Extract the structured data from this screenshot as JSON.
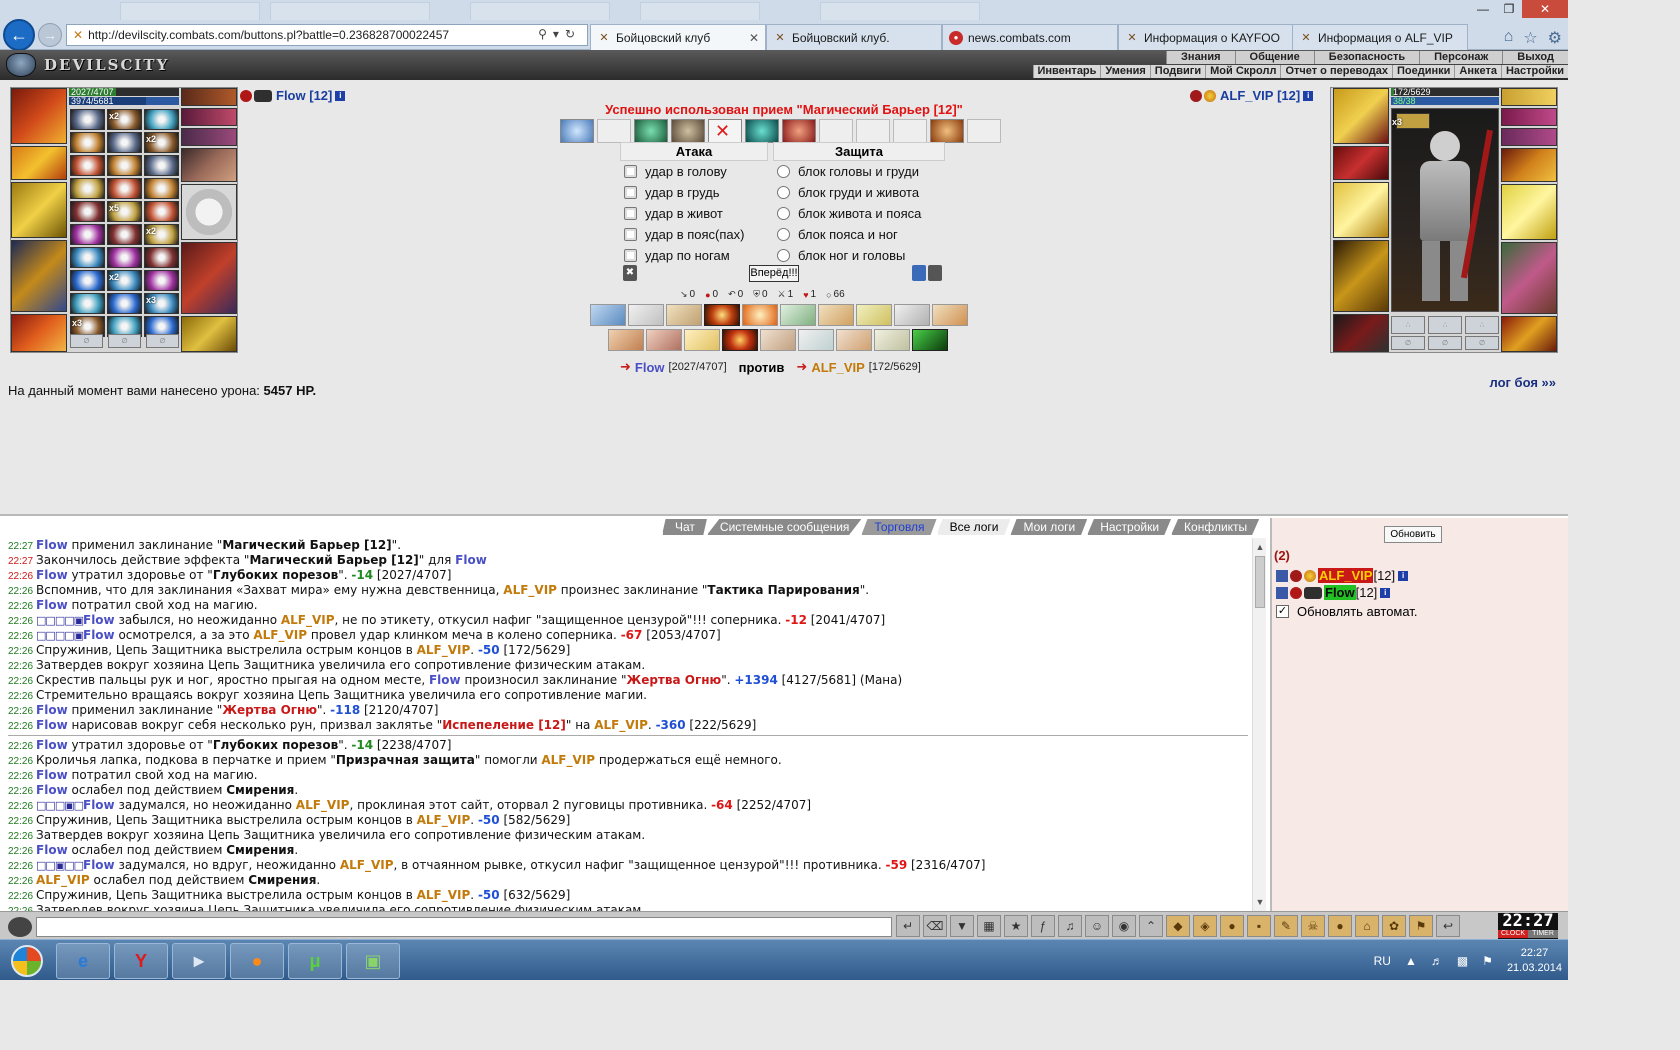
{
  "browser": {
    "url": "http://devilscity.combats.com/buttons.pl?battle=0.236828700022457",
    "url_host": "devilscity.combats.com",
    "tabs": [
      {
        "label": "Бойцовский клуб",
        "active": true
      },
      {
        "label": "Бойцовский клуб.",
        "active": false
      },
      {
        "label": "news.combats.com",
        "active": false
      },
      {
        "label": "Информация о KAYFOO",
        "active": false
      },
      {
        "label": "Информация о ALF_VIP",
        "active": false
      }
    ]
  },
  "game": {
    "logo_text": "DEVILSCITY",
    "top_menu": [
      "Знания",
      "Общение",
      "Безопасность",
      "Персонаж",
      "Выход"
    ],
    "sub_menu": [
      "Инвентарь",
      "Умения",
      "Подвиги",
      "Мой Скролл",
      "Отчет о переводах",
      "Поединки",
      "Анкета",
      "Настройки"
    ]
  },
  "battle": {
    "player": {
      "name": "Flow",
      "level": "[12]",
      "hp_text": "2027/4707",
      "mana_text": "3974/5681",
      "hp_fraction": 0.43,
      "mana_fraction": 0.7
    },
    "enemy": {
      "name": "ALF_VIP",
      "level": "[12]",
      "hp_text": "172/5629",
      "mana_text": "38/38",
      "hp_fraction": 0.03,
      "mana_fraction": 1.0
    },
    "success_message": "Успешно использован прием \"Магический Барьер [12]\"",
    "attack_header": "Атака",
    "defense_header": "Защита",
    "attack_options": [
      "удар в голову",
      "удар в грудь",
      "удар в живот",
      "удар в пояс(пах)",
      "удар по ногам"
    ],
    "defense_options": [
      "блок головы и груди",
      "блок груди и живота",
      "блок живота и пояса",
      "блок пояса и ног",
      "блок ног и головы"
    ],
    "forward_button": "Вперёд!!!",
    "stats": [
      "0",
      "0",
      "0",
      "0",
      "1",
      "1",
      "66"
    ],
    "vs_player_name": "Flow",
    "vs_player_hp": "[2027/4707]",
    "vs_label": "против",
    "vs_enemy_name": "ALF_VIP",
    "vs_enemy_hp": "[172/5629]",
    "damage_prefix": "На данный момент вами нанесено урона:",
    "damage_value": "5457 HP.",
    "log_link": "лог боя »»"
  },
  "chat": {
    "tabs": [
      {
        "label": "Чат",
        "state": "normal"
      },
      {
        "label": "Системные сообщения",
        "state": "normal"
      },
      {
        "label": "Торговля",
        "state": "trade"
      },
      {
        "label": "Все логи",
        "state": "active"
      },
      {
        "label": "Мои логи",
        "state": "normal"
      },
      {
        "label": "Настройки",
        "state": "normal"
      },
      {
        "label": "Конфликты",
        "state": "normal"
      }
    ],
    "refresh_button": "Обновить",
    "player_count": "(2)",
    "players": [
      {
        "name": "ALF_VIP",
        "level": "[12]"
      },
      {
        "name": "Flow",
        "level": "[12]"
      }
    ],
    "auto_refresh_label": "Обновлять автомат."
  },
  "log": [
    {
      "t": "22:27",
      "red": false,
      "parts": [
        [
          "p1",
          "Flow"
        ],
        [
          "n",
          " применил заклинание \""
        ],
        [
          "b",
          "Магический Барьер [12]"
        ],
        [
          "n",
          "\"."
        ]
      ]
    },
    {
      "t": "22:27",
      "red": true,
      "parts": [
        [
          "n",
          "Закончилось действие эффекта \""
        ],
        [
          "b",
          "Магический Барьер [12]"
        ],
        [
          "n",
          "\" для "
        ],
        [
          "p1",
          "Flow"
        ]
      ]
    },
    {
      "t": "22:26",
      "red": true,
      "parts": [
        [
          "p1",
          "Flow"
        ],
        [
          "n",
          " утратил здоровье от \""
        ],
        [
          "b",
          "Глубоких порезов"
        ],
        [
          "n",
          "\". "
        ],
        [
          "neg-g",
          "-14"
        ],
        [
          "n",
          " [2027/4707]"
        ]
      ]
    },
    {
      "t": "22:26",
      "red": false,
      "parts": [
        [
          "n",
          "Вспомнив, что для заклинания «Захват мира» ему нужна девственница, "
        ],
        [
          "p2",
          "ALF_VIP"
        ],
        [
          "n",
          " произнес заклинание \""
        ],
        [
          "b",
          "Тактика Парирования"
        ],
        [
          "n",
          "\"."
        ]
      ]
    },
    {
      "t": "22:26",
      "red": false,
      "parts": [
        [
          "p1",
          "Flow"
        ],
        [
          "n",
          " потратил свой ход на магию."
        ]
      ]
    },
    {
      "t": "22:26",
      "red": false,
      "parts": [
        [
          "sq",
          "□□□□▣"
        ],
        [
          "p1",
          "Flow"
        ],
        [
          "n",
          " забылся, но неожиданно "
        ],
        [
          "p2",
          "ALF_VIP"
        ],
        [
          "n",
          ", не по этикету, откусил нафиг \"защищенное цензурой\"!!! соперника. "
        ],
        [
          "neg",
          "-12"
        ],
        [
          "n",
          " [2041/4707]"
        ]
      ]
    },
    {
      "t": "22:26",
      "red": false,
      "parts": [
        [
          "sq",
          "□□□□▣"
        ],
        [
          "p1",
          "Flow"
        ],
        [
          "n",
          " осмотрелся, а за это "
        ],
        [
          "p2",
          "ALF_VIP"
        ],
        [
          "n",
          " провел удар клинком меча в колено соперника. "
        ],
        [
          "neg",
          "-67"
        ],
        [
          "n",
          " [2053/4707]"
        ]
      ]
    },
    {
      "t": "22:26",
      "red": false,
      "parts": [
        [
          "n",
          "Спружинив, Цепь Защитника выстрелила острым концов в "
        ],
        [
          "p2",
          "ALF_VIP"
        ],
        [
          "n",
          ". "
        ],
        [
          "neg-b",
          "-50"
        ],
        [
          "n",
          " [172/5629]"
        ]
      ]
    },
    {
      "t": "22:26",
      "red": false,
      "parts": [
        [
          "n",
          "Затвердев вокруг хозяина Цепь Защитника увеличила его сопротивление физическим атакам."
        ]
      ]
    },
    {
      "t": "22:26",
      "red": false,
      "parts": [
        [
          "n",
          "Скрестив пальцы рук и ног, яростно прыгая на одном месте, "
        ],
        [
          "p1",
          "Flow"
        ],
        [
          "n",
          " произносил заклинание \""
        ],
        [
          "b red",
          "Жертва Огню"
        ],
        [
          "n",
          "\". "
        ],
        [
          "pos",
          "+1394"
        ],
        [
          "n",
          " [4127/5681] (Мана)"
        ]
      ]
    },
    {
      "t": "22:26",
      "red": false,
      "parts": [
        [
          "n",
          "Стремительно вращаясь вокруг хозяина Цепь Защитника увеличила его сопротивление магии."
        ]
      ]
    },
    {
      "t": "22:26",
      "red": false,
      "parts": [
        [
          "p1",
          "Flow"
        ],
        [
          "n",
          " применил заклинание \""
        ],
        [
          "b red",
          "Жертва Огню"
        ],
        [
          "n",
          "\". "
        ],
        [
          "neg-b",
          "-118"
        ],
        [
          "n",
          " [2120/4707]"
        ]
      ]
    },
    {
      "t": "22:26",
      "red": false,
      "parts": [
        [
          "p1",
          "Flow"
        ],
        [
          "n",
          " нарисовав вокруг себя несколько рун, призвал заклятье \""
        ],
        [
          "b red",
          "Испепеление [12]"
        ],
        [
          "n",
          "\" на "
        ],
        [
          "p2",
          "ALF_VIP"
        ],
        [
          "n",
          ". "
        ],
        [
          "neg-b",
          "-360"
        ],
        [
          "n",
          " [222/5629]"
        ]
      ]
    },
    {
      "t": "sep"
    },
    {
      "t": "22:26",
      "red": false,
      "parts": [
        [
          "p1",
          "Flow"
        ],
        [
          "n",
          " утратил здоровье от \""
        ],
        [
          "b",
          "Глубоких порезов"
        ],
        [
          "n",
          "\". "
        ],
        [
          "neg-g",
          "-14"
        ],
        [
          "n",
          " [2238/4707]"
        ]
      ]
    },
    {
      "t": "22:26",
      "red": false,
      "parts": [
        [
          "n",
          "Кроличья лапка, подкова в перчатке и прием \""
        ],
        [
          "b",
          "Призрачная защита"
        ],
        [
          "n",
          "\" помогли "
        ],
        [
          "p2",
          "ALF_VIP"
        ],
        [
          "n",
          " продержаться ещё немного."
        ]
      ]
    },
    {
      "t": "22:26",
      "red": false,
      "parts": [
        [
          "p1",
          "Flow"
        ],
        [
          "n",
          " потратил свой ход на магию."
        ]
      ]
    },
    {
      "t": "22:26",
      "red": false,
      "parts": [
        [
          "p1",
          "Flow"
        ],
        [
          "n",
          " ослабел под действием "
        ],
        [
          "b",
          "Смирения"
        ],
        [
          "n",
          "."
        ]
      ]
    },
    {
      "t": "22:26",
      "red": false,
      "parts": [
        [
          "sq",
          "□□□▣□"
        ],
        [
          "p1",
          "Flow"
        ],
        [
          "n",
          " задумался, но неожиданно "
        ],
        [
          "p2",
          "ALF_VIP"
        ],
        [
          "n",
          ", проклиная этот сайт, оторвал 2 пуговицы противника. "
        ],
        [
          "neg",
          "-64"
        ],
        [
          "n",
          " [2252/4707]"
        ]
      ]
    },
    {
      "t": "22:26",
      "red": false,
      "parts": [
        [
          "n",
          "Спружинив, Цепь Защитника выстрелила острым концов в "
        ],
        [
          "p2",
          "ALF_VIP"
        ],
        [
          "n",
          ". "
        ],
        [
          "neg-b",
          "-50"
        ],
        [
          "n",
          " [582/5629]"
        ]
      ]
    },
    {
      "t": "22:26",
      "red": false,
      "parts": [
        [
          "n",
          "Затвердев вокруг хозяина Цепь Защитника увеличила его сопротивление физическим атакам."
        ]
      ]
    },
    {
      "t": "22:26",
      "red": false,
      "parts": [
        [
          "p1",
          "Flow"
        ],
        [
          "n",
          " ослабел под действием "
        ],
        [
          "b",
          "Смирения"
        ],
        [
          "n",
          "."
        ]
      ]
    },
    {
      "t": "22:26",
      "red": false,
      "parts": [
        [
          "sq",
          "□□▣□□"
        ],
        [
          "p1",
          "Flow"
        ],
        [
          "n",
          " задумался, но вдруг, неожиданно "
        ],
        [
          "p2",
          "ALF_VIP"
        ],
        [
          "n",
          ", в отчаянном рывке, откусил нафиг \"защищенное цензурой\"!!! противника. "
        ],
        [
          "neg",
          "-59"
        ],
        [
          "n",
          " [2316/4707]"
        ]
      ]
    },
    {
      "t": "22:26",
      "red": false,
      "parts": [
        [
          "p2",
          "ALF_VIP"
        ],
        [
          "n",
          " ослабел под действием "
        ],
        [
          "b",
          "Смирения"
        ],
        [
          "n",
          "."
        ]
      ]
    },
    {
      "t": "22:26",
      "red": false,
      "parts": [
        [
          "n",
          "Спружинив, Цепь Защитника выстрелила острым концов в "
        ],
        [
          "p2",
          "ALF_VIP"
        ],
        [
          "n",
          ". "
        ],
        [
          "neg-b",
          "-50"
        ],
        [
          "n",
          " [632/5629]"
        ]
      ]
    },
    {
      "t": "22:26",
      "red": false,
      "parts": [
        [
          "n",
          "Затвердев вокруг хозяина Цепь Защитника увеличила его сопротивление физическим атакам."
        ]
      ]
    }
  ],
  "clock": {
    "time": "22:27",
    "clock_label": "CLOCK",
    "timer_label": "TIMER"
  },
  "taskbar": {
    "lang": "RU",
    "time": "22:27",
    "date": "21.03.2014"
  }
}
